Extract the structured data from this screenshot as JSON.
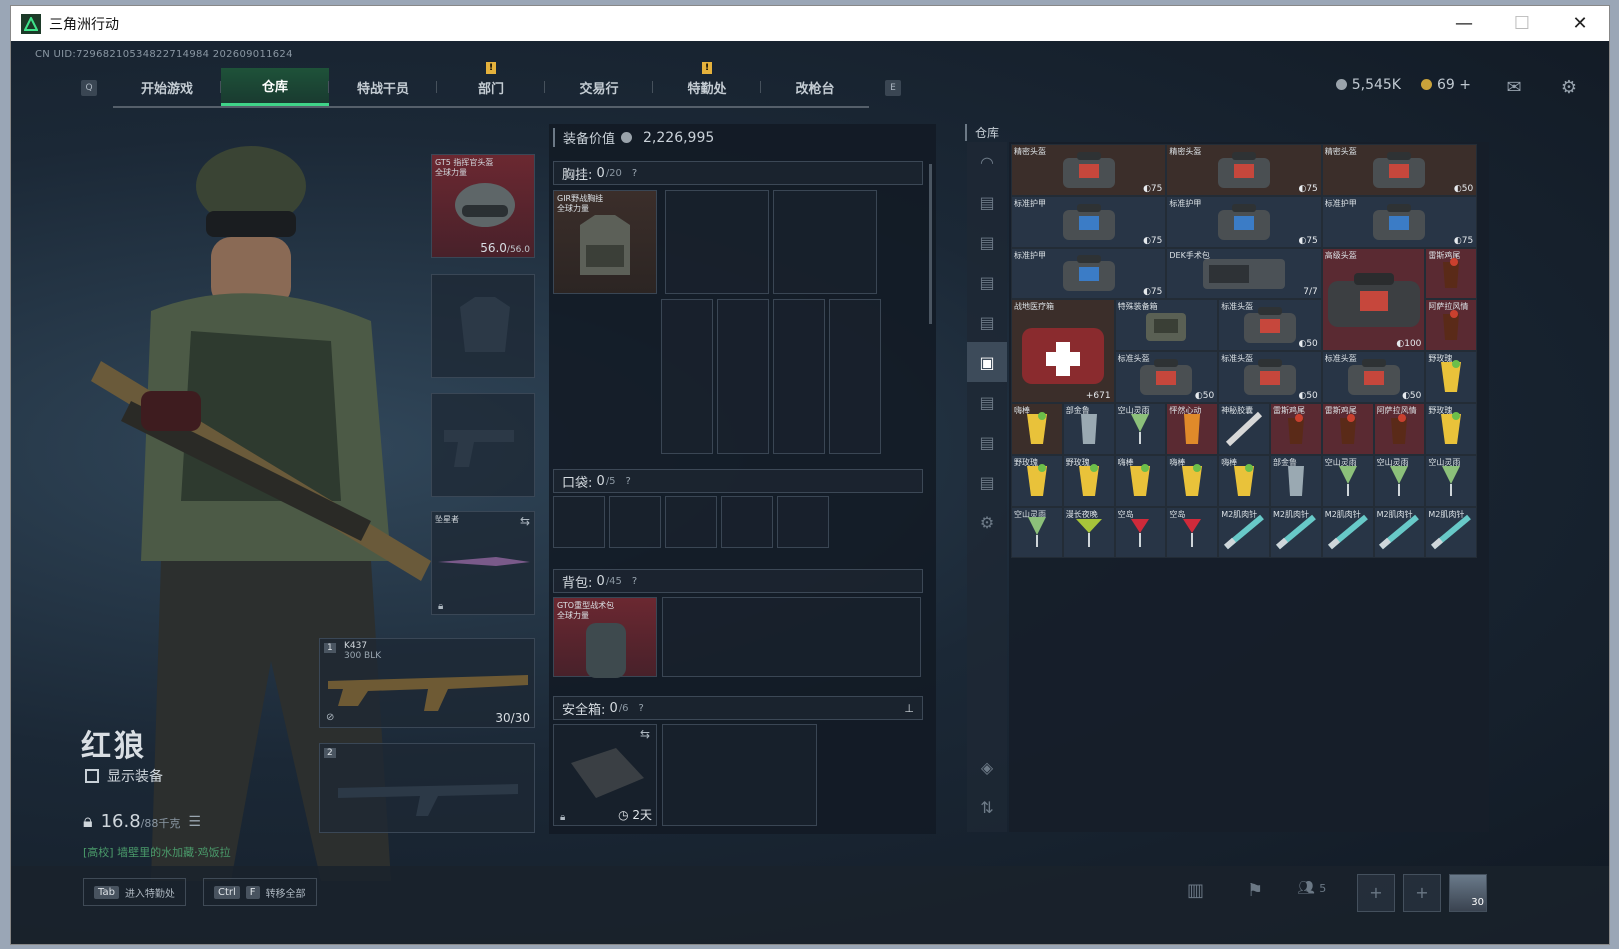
{
  "window": {
    "title": "三角洲行动",
    "minimize": "—",
    "maximize": "☐",
    "close": "✕"
  },
  "uid": "CN UID:72968210534822714984 202609011624",
  "nav": {
    "left_key": "Q",
    "right_key": "E",
    "tabs": [
      {
        "label": "开始游戏",
        "active": false,
        "alert": false
      },
      {
        "label": "仓库",
        "active": true,
        "alert": false
      },
      {
        "label": "特战干员",
        "active": false,
        "alert": false
      },
      {
        "label": "部门",
        "active": false,
        "alert": true
      },
      {
        "label": "交易行",
        "active": false,
        "alert": false
      },
      {
        "label": "特勤处",
        "active": false,
        "alert": true
      },
      {
        "label": "改枪台",
        "active": false,
        "alert": false
      }
    ]
  },
  "currency": {
    "coins": "5,545K",
    "gold": "69",
    "add": "+"
  },
  "character": {
    "name": "红狼",
    "show_equip": "显示装备",
    "weight": "16.8",
    "weight_max": "/88千克",
    "hint": "[高校] 墙壁里的水加藏·鸡饭拉"
  },
  "equipment": {
    "helmet": {
      "label": "GT5 指挥官头盔\n全球力量",
      "durability": "56.0",
      "durability_max": "/56.0"
    },
    "melee": {
      "label": "坠星者"
    },
    "primary": {
      "slot": "1",
      "name": "K437",
      "ammo_type": "300 BLK",
      "ammo": "30/30"
    },
    "secondary": {
      "slot": "2"
    }
  },
  "loadout": {
    "value_label": "装备价值",
    "value": "2,226,995",
    "chest": {
      "label": "胸挂:",
      "count": "0",
      "cap": "/20",
      "item": "GIR野战胸挂\n全球力量"
    },
    "pocket": {
      "label": "口袋:",
      "count": "0",
      "cap": "/5"
    },
    "backpack": {
      "label": "背包:",
      "count": "0",
      "cap": "/45",
      "item": "GTO重型战术包\n全球力量"
    },
    "safebox": {
      "label": "安全箱:",
      "count": "0",
      "cap": "/6",
      "timer": "2天"
    }
  },
  "warehouse": {
    "title": "仓库",
    "items": [
      {
        "name": "精密头盔",
        "val": "◐75",
        "color": "#3b2e2a",
        "icon": "bag"
      },
      {
        "name": "精密头盔",
        "val": "◐75",
        "color": "#3b2e2a",
        "icon": "bag"
      },
      {
        "name": "精密头盔",
        "val": "◐50",
        "color": "#3b2e2a",
        "icon": "bag"
      },
      {
        "name": "标准护甲",
        "val": "◐75",
        "color": "#283546",
        "icon": "armor"
      },
      {
        "name": "标准护甲",
        "val": "◐75",
        "color": "#283546",
        "icon": "armor"
      },
      {
        "name": "标准护甲",
        "val": "◐75",
        "color": "#283546",
        "icon": "armor"
      },
      {
        "name": "标准护甲",
        "val": "◐75",
        "color": "#283546",
        "icon": "armor"
      },
      {
        "name": "DEK手术包",
        "val": "7/7",
        "color": "#283546",
        "icon": "kit"
      },
      {
        "name": "高级头盔",
        "val": "◐100",
        "color": "#5a2a32",
        "icon": "bigbag"
      },
      {
        "name": "雷斯鸡尾",
        "val": "",
        "color": "#5a2a32",
        "icon": "drink-dark"
      },
      {
        "name": "战地医疗箱",
        "val": "+671",
        "color": "#3b2e2a",
        "icon": "medkit"
      },
      {
        "name": "特殊装备箱",
        "val": "",
        "color": "#283546",
        "icon": "case"
      },
      {
        "name": "标准头盔",
        "val": "◐50",
        "color": "#283546",
        "icon": "bag"
      },
      {
        "name": "阿萨拉风情",
        "val": "",
        "color": "#5a2a32",
        "icon": "drink-dark"
      },
      {
        "name": "标准头盔",
        "val": "◐50",
        "color": "#283546",
        "icon": "bag"
      },
      {
        "name": "标准头盔",
        "val": "◐50",
        "color": "#283546",
        "icon": "bag"
      },
      {
        "name": "标准头盔",
        "val": "◐50",
        "color": "#283546",
        "icon": "bag"
      },
      {
        "name": "野玫瑰",
        "val": "",
        "color": "#283546",
        "icon": "drink-y"
      },
      {
        "name": "嗨棒",
        "val": "",
        "color": "#3b2e2a",
        "icon": "drink-y"
      },
      {
        "name": "部金鲁",
        "val": "",
        "color": "#283546",
        "icon": "drink-c"
      },
      {
        "name": "空山灵雨",
        "val": "",
        "color": "#283546",
        "icon": "drink-g"
      },
      {
        "name": "怦然心动",
        "val": "",
        "color": "#5a2a32",
        "icon": "drink-o"
      },
      {
        "name": "神秘胶囊",
        "val": "",
        "color": "#283546",
        "icon": "tape"
      },
      {
        "name": "雷斯鸡尾",
        "val": "",
        "color": "#5a2a32",
        "icon": "drink-dark"
      },
      {
        "name": "雷斯鸡尾",
        "val": "",
        "color": "#5a2a32",
        "icon": "drink-dark"
      },
      {
        "name": "阿萨拉风情",
        "val": "",
        "color": "#5a2a32",
        "icon": "drink-dark"
      },
      {
        "name": "野玫瑰",
        "val": "",
        "color": "#283546",
        "icon": "drink-y"
      },
      {
        "name": "野玫瑰",
        "val": "",
        "color": "#283546",
        "icon": "drink-y"
      },
      {
        "name": "野玫瑰",
        "val": "",
        "color": "#283546",
        "icon": "drink-y"
      },
      {
        "name": "嗨棒",
        "val": "",
        "color": "#283546",
        "icon": "drink-y"
      },
      {
        "name": "嗨棒",
        "val": "",
        "color": "#283546",
        "icon": "drink-y"
      },
      {
        "name": "嗨棒",
        "val": "",
        "color": "#283546",
        "icon": "drink-y"
      },
      {
        "name": "部金鲁",
        "val": "",
        "color": "#283546",
        "icon": "drink-c"
      },
      {
        "name": "空山灵雨",
        "val": "",
        "color": "#283546",
        "icon": "drink-g"
      },
      {
        "name": "空山灵雨",
        "val": "",
        "color": "#283546",
        "icon": "drink-g"
      },
      {
        "name": "空山灵雨",
        "val": "",
        "color": "#283546",
        "icon": "drink-g"
      },
      {
        "name": "空山灵雨",
        "val": "",
        "color": "#283546",
        "icon": "drink-g"
      },
      {
        "name": "漫长夜晚",
        "val": "",
        "color": "#283546",
        "icon": "drink-m"
      },
      {
        "name": "空岛",
        "val": "",
        "color": "#283546",
        "icon": "drink-r"
      },
      {
        "name": "空岛",
        "val": "",
        "color": "#283546",
        "icon": "drink-r"
      },
      {
        "name": "M2肌肉针",
        "val": "",
        "color": "#283546",
        "icon": "syringe"
      },
      {
        "name": "M2肌肉针",
        "val": "",
        "color": "#283546",
        "icon": "syringe"
      },
      {
        "name": "M2肌肉针",
        "val": "",
        "color": "#283546",
        "icon": "syringe"
      },
      {
        "name": "M2肌肉针",
        "val": "",
        "color": "#283546",
        "icon": "syringe"
      },
      {
        "name": "M2肌肉针",
        "val": "",
        "color": "#283546",
        "icon": "syringe"
      }
    ]
  },
  "bottom": {
    "tab_key": "Tab",
    "tab_label": "进入特勤处",
    "ctrl_key": "Ctrl",
    "f_key": "F",
    "transfer_label": "转移全部",
    "squad": "5",
    "avatar_level": "30"
  }
}
